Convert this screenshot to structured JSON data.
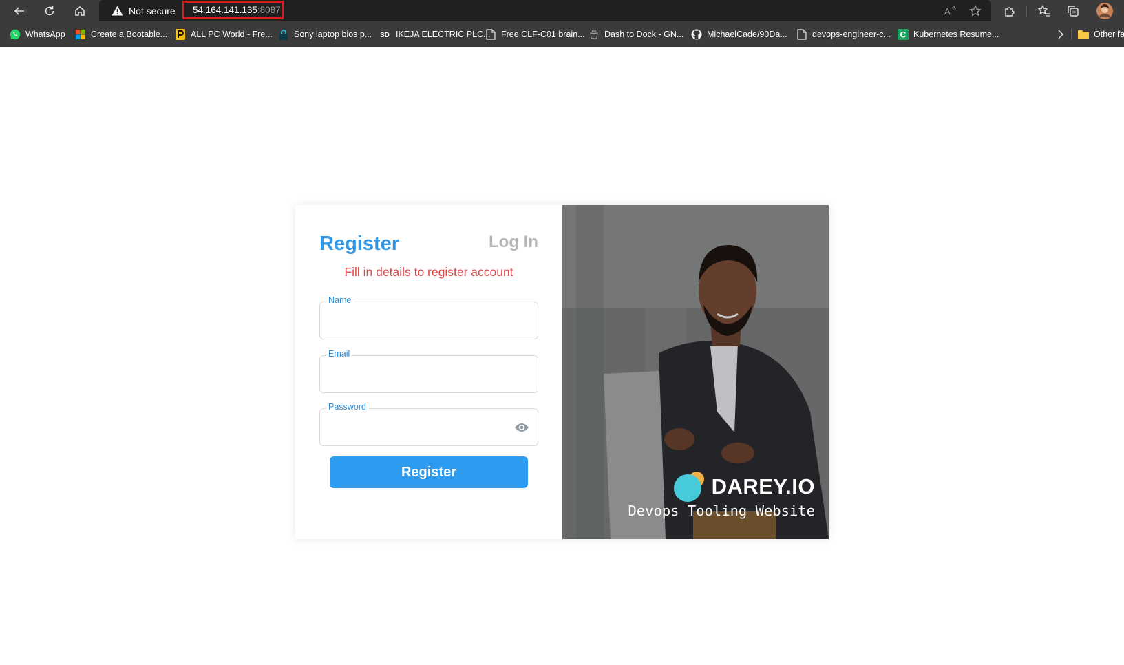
{
  "browser": {
    "security_label": "Not secure",
    "url_host": "54.164.141.135",
    "url_port": ":8087",
    "highlight_color": "#e01b1b",
    "nav_icons": [
      "back-arrow-icon",
      "refresh-icon",
      "home-icon",
      "warning-icon"
    ],
    "toolbar_icons": [
      "read-aloud-icon",
      "add-favorite-icon",
      "extensions-icon",
      "favorites-icon",
      "collections-icon",
      "profile-avatar-icon"
    ]
  },
  "bookmarks": {
    "items": [
      {
        "label": "WhatsApp",
        "icon": "whatsapp-icon"
      },
      {
        "label": "Create a Bootable...",
        "icon": "windows-icon"
      },
      {
        "label": "ALL PC World - Fre...",
        "icon": "pcworld-icon"
      },
      {
        "label": "Sony laptop bios p...",
        "icon": "lock-icon"
      },
      {
        "label": "IKEJA ELECTRIC PLC...",
        "icon": "sd-icon"
      },
      {
        "label": "Free CLF-C01 brain...",
        "icon": "document-icon"
      },
      {
        "label": "Dash to Dock - GN...",
        "icon": "gnome-icon"
      },
      {
        "label": "MichaelCade/90Da...",
        "icon": "github-icon"
      },
      {
        "label": "devops-engineer-c...",
        "icon": "document-icon"
      },
      {
        "label": "Kubernetes Resume...",
        "icon": "c-icon"
      }
    ],
    "overflow_icon": "chevron-right-icon",
    "other_label": "Other fa"
  },
  "form": {
    "tab_register": "Register",
    "tab_login": "Log In",
    "subtitle": "Fill in details to register account",
    "fields": {
      "name": {
        "label": "Name",
        "value": ""
      },
      "email": {
        "label": "Email",
        "value": ""
      },
      "password": {
        "label": "Password",
        "value": "",
        "toggle_icon": "eye-icon"
      }
    },
    "submit_label": "Register",
    "accent_color": "#3397e3",
    "subtitle_color": "#e0474b",
    "button_color": "#2d9bf0"
  },
  "hero": {
    "brand_name": "DAREY.IO",
    "tagline": "Devops Tooling Website",
    "brand_logo_icon": "darey-logo-icon"
  }
}
